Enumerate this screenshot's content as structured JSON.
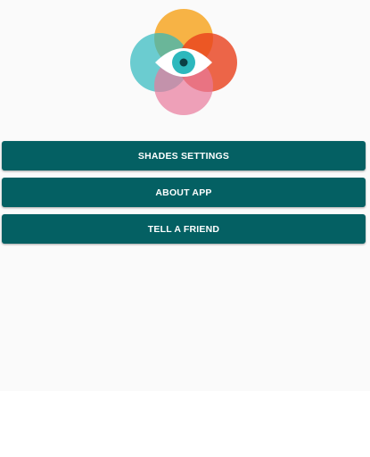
{
  "app": {
    "logo_icon": "eye-shades-logo-icon",
    "colors": {
      "background": "#fafafa",
      "button": "#046063",
      "button_text": "#ffffff",
      "logo_orange": "#f7a41d",
      "logo_teal": "#2db8bd",
      "logo_red": "#e8401c",
      "logo_pink": "#e8799b"
    }
  },
  "menu": {
    "shades_settings_label": "SHADES SETTINGS",
    "about_app_label": "ABOUT APP",
    "tell_a_friend_label": "TELL A FRIEND"
  }
}
